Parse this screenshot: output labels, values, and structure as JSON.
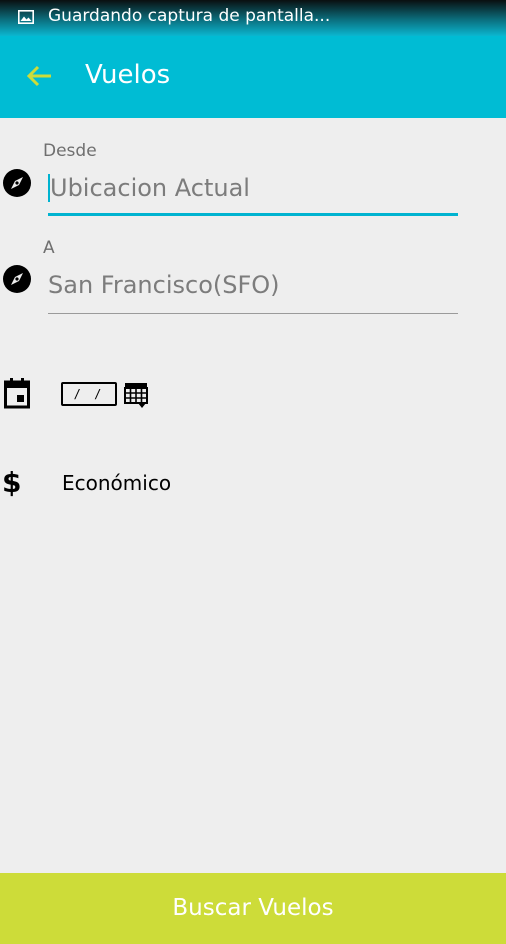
{
  "status_bar": {
    "notification_icon": "image-icon",
    "text": "Guardando captura de pantalla..."
  },
  "app_bar": {
    "back_icon": "arrow-back-icon",
    "title": "Vuelos",
    "background_color": "#00bcd4",
    "back_icon_color": "#cddc39"
  },
  "form": {
    "from": {
      "icon": "compass-icon",
      "label": "Desde",
      "value": "Ubicacion Actual",
      "focused": true
    },
    "to": {
      "icon": "compass-icon",
      "label": "A",
      "value": "San Francisco(SFO)"
    },
    "date": {
      "icon": "calendar-icon",
      "value": "/ /",
      "picker_icon": "date-picker-icon"
    },
    "class": {
      "icon": "dollar-icon",
      "value": "Económico"
    }
  },
  "search_button": {
    "label": "Buscar Vuelos",
    "background_color": "#cddc39"
  }
}
